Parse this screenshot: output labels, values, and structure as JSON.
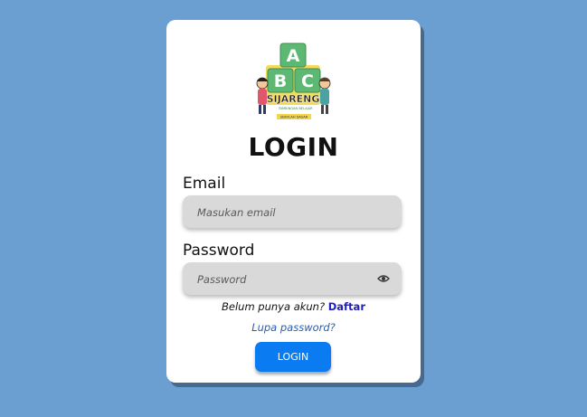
{
  "logo": {
    "blocks": [
      "A",
      "B",
      "C"
    ],
    "brand": "SIJARENG",
    "tagline": "BIMBINGAN BELAJAR",
    "subtitle": "SEKOLAH DASAR"
  },
  "title": "LOGIN",
  "email": {
    "label": "Email",
    "placeholder": "Masukan email",
    "value": ""
  },
  "password": {
    "label": "Password",
    "placeholder": "Password",
    "value": ""
  },
  "signup": {
    "prompt": "Belum punya akun?",
    "link": "Daftar"
  },
  "forgot_label": "Lupa password?",
  "login_button": "LOGIN",
  "colors": {
    "background": "#6b9fd2",
    "card": "#ffffff",
    "field": "#d9d9d9",
    "primary_button": "#0a7bf0",
    "signup_link": "#1e1ec8",
    "forgot_link": "#2a5ea8",
    "block_green": "#5db873",
    "block_yellow": "#f2d64b"
  },
  "icons": {
    "password_toggle": "eye-icon"
  }
}
